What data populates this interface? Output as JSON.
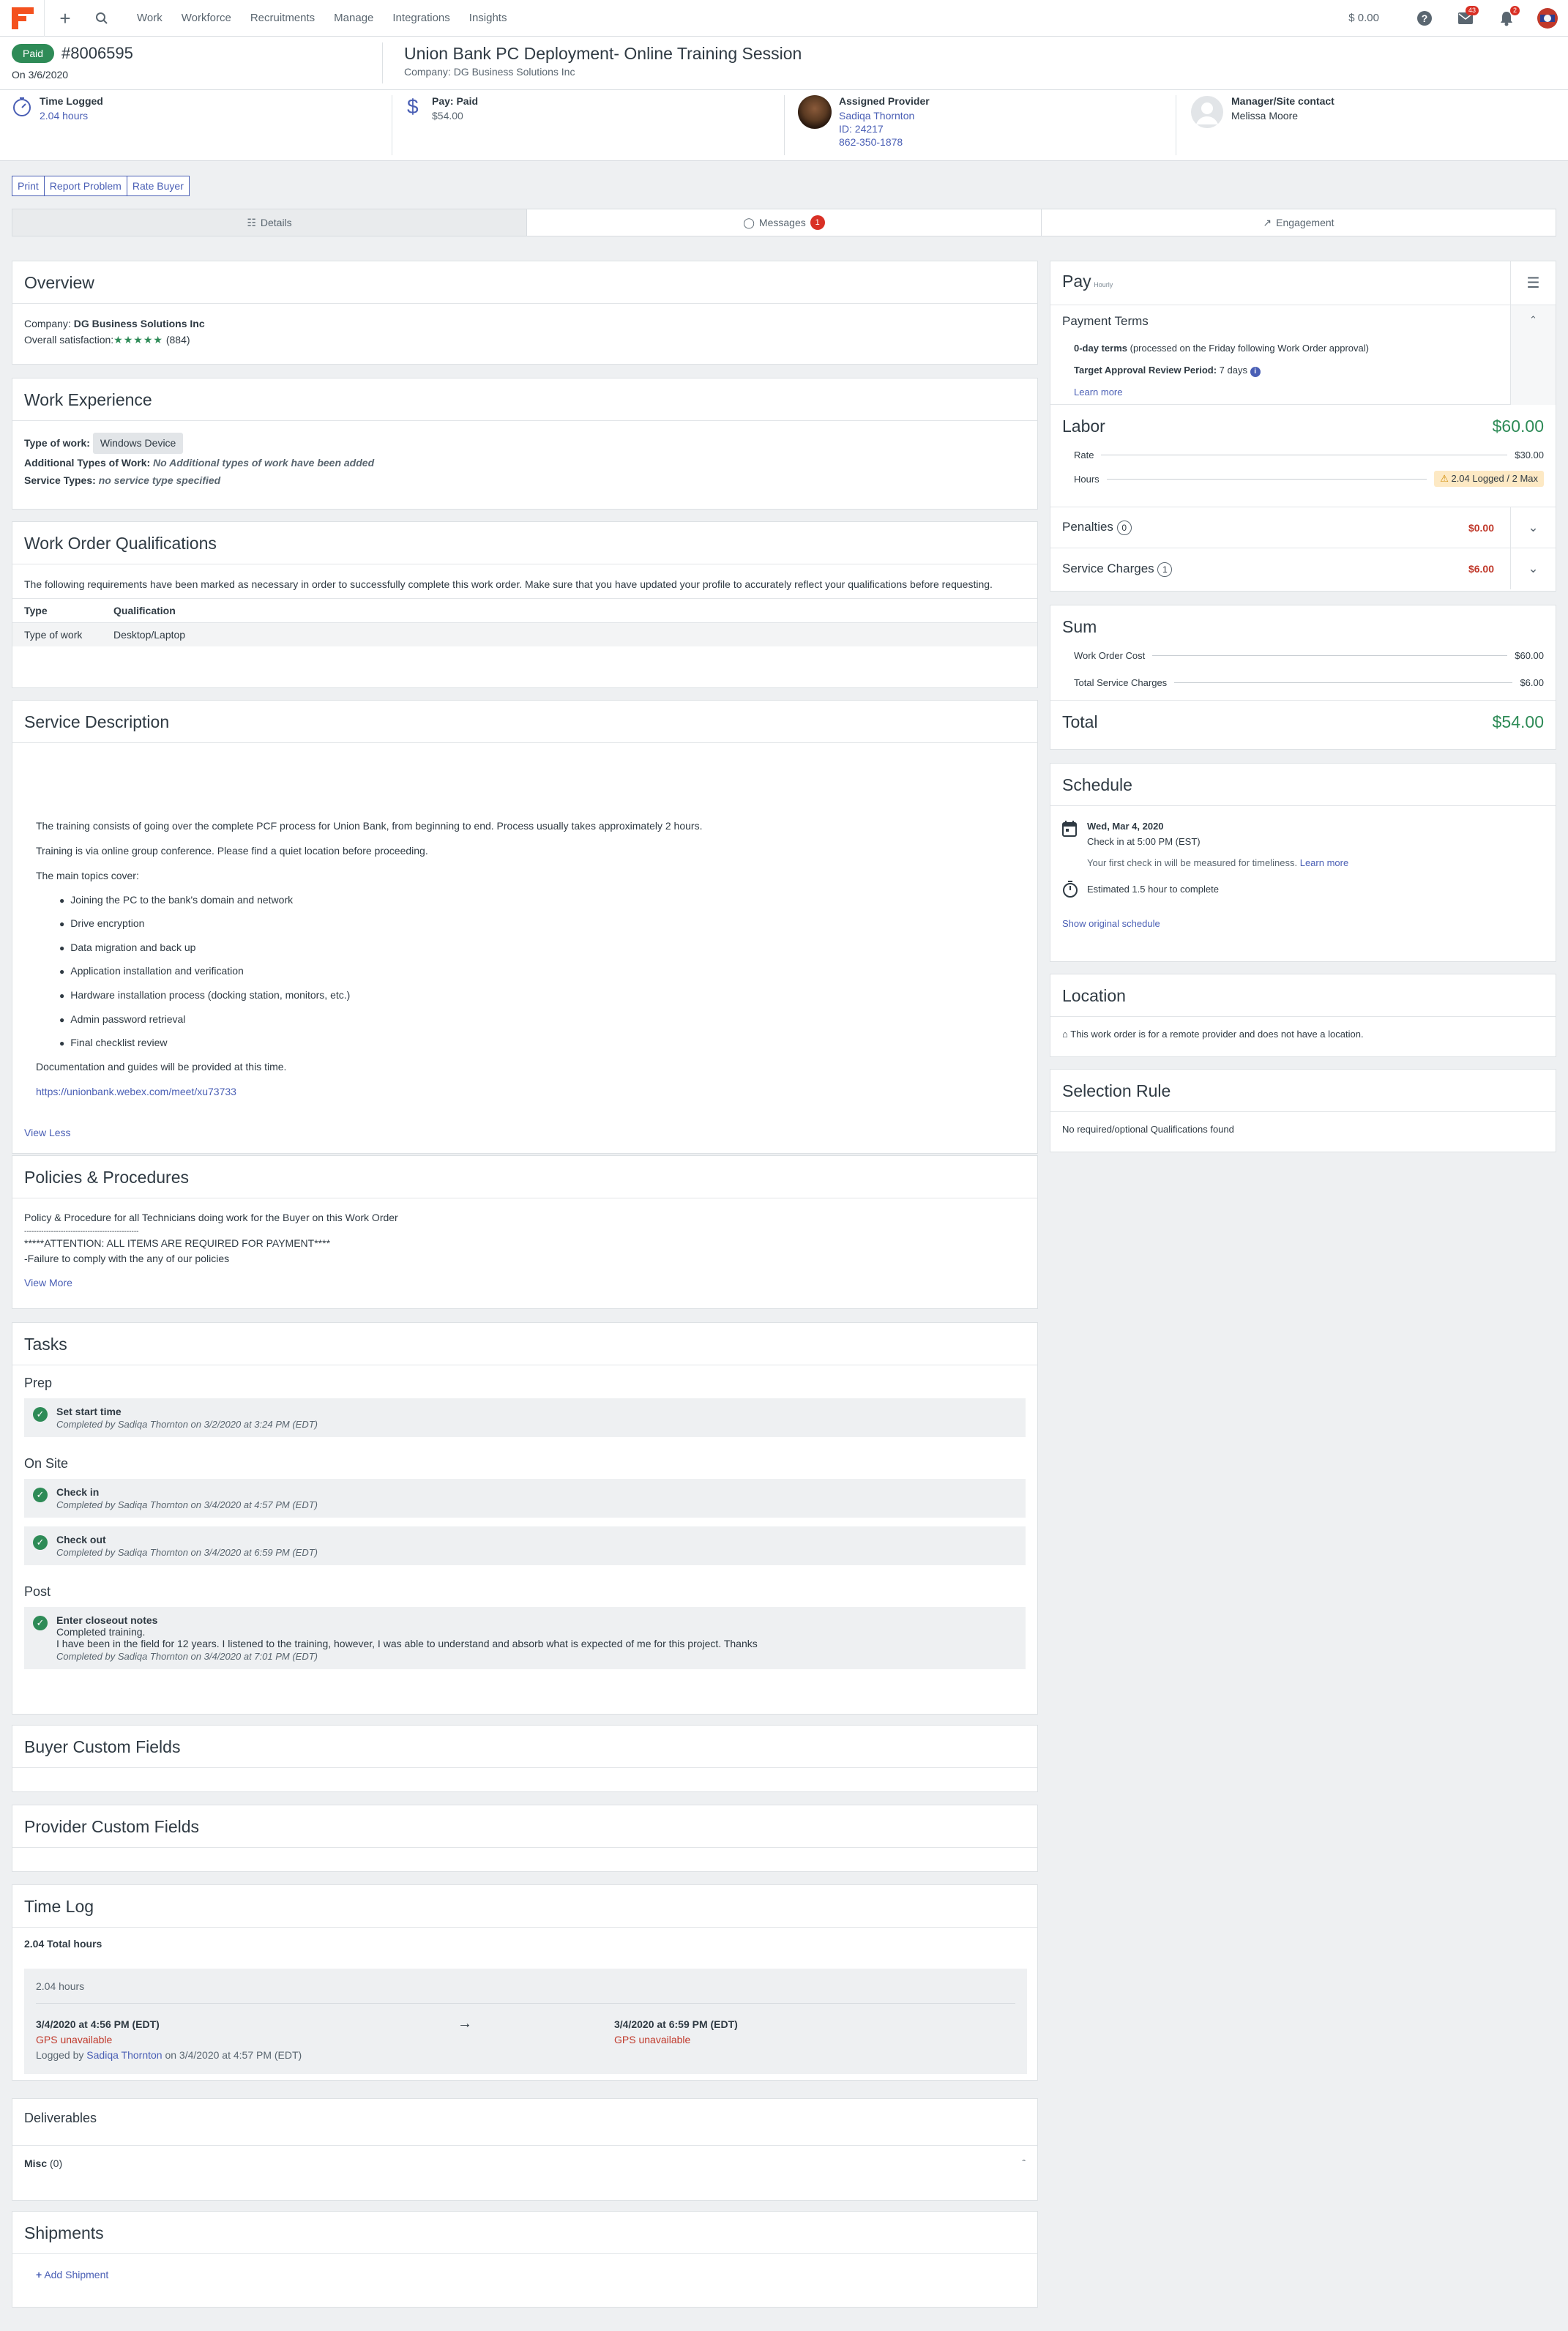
{
  "nav": {
    "items": [
      "Work",
      "Workforce",
      "Recruitments",
      "Manage",
      "Integrations",
      "Insights"
    ],
    "balance": "0.00",
    "messages_badge": "43",
    "notifications_badge": "2"
  },
  "header": {
    "status": "Paid",
    "work_order_number": "#8006595",
    "date": "On 3/6/2020",
    "title": "Union Bank PC Deployment- Online Training Session",
    "company": "Company: DG Business Solutions Inc",
    "time_logged_label": "Time Logged",
    "time_logged_value": "2.04 hours",
    "pay_label": "Pay: Paid",
    "pay_value": "$54.00",
    "provider_label": "Assigned Provider",
    "provider_name": "Sadiqa Thornton",
    "provider_id": "ID: 24217",
    "provider_phone": "862-350-1878",
    "manager_label": "Manager/Site contact",
    "manager_name": "Melissa Moore"
  },
  "actions": [
    "Print",
    "Report Problem",
    "Rate Buyer"
  ],
  "tabs": {
    "details": "Details",
    "messages": "Messages",
    "messages_count": "1",
    "engagement": "Engagement"
  },
  "overview": {
    "title": "Overview",
    "company_label": "Company:",
    "company_value": "DG Business Solutions Inc",
    "satisfaction_label": "Overall satisfaction:",
    "stars": "★★★★★",
    "rating_count": "(884)"
  },
  "work_experience": {
    "title": "Work Experience",
    "type_label": "Type of work:",
    "type_value": "Windows Device",
    "additional_label": "Additional Types of Work:",
    "additional_value": "No Additional types of work have been added",
    "service_label": "Service Types:",
    "service_value": "no service type specified"
  },
  "qualifications": {
    "title": "Work Order Qualifications",
    "intro": "The following requirements have been marked as necessary in order to successfully complete this work order. Make sure that you have updated your profile to accurately reflect your qualifications before requesting.",
    "headers": [
      "Type",
      "Qualification"
    ],
    "rows": [
      [
        "Type of work",
        "Desktop/Laptop"
      ]
    ]
  },
  "service_description": {
    "title": "Service Description",
    "p1": "The training consists of going over the complete PCF process for Union Bank, from beginning to end. Process usually takes approximately 2 hours.",
    "p2": "Training is via online group conference. Please find a quiet location before proceeding.",
    "p3": "The main topics cover:",
    "topics": [
      "Joining the PC to the bank's domain and network",
      "Drive encryption",
      "Data migration and back up",
      "Application installation and verification",
      "Hardware installation process (docking station, monitors, etc.)",
      "Admin password retrieval",
      "Final checklist review"
    ],
    "p4": "Documentation and guides will be provided at this time.",
    "url": "https://unionbank.webex.com/meet/xu73733",
    "view_less": "View Less"
  },
  "policies": {
    "title": "Policies & Procedures",
    "l1": "Policy & Procedure for all Technicians doing work for the Buyer on this Work Order",
    "l2": "-----------------------------------------------",
    "l3": "*****ATTENTION: ALL ITEMS ARE REQUIRED FOR PAYMENT****",
    "l4": "-Failure to comply with the any of our policies",
    "view_more": "View More"
  },
  "tasks": {
    "title": "Tasks",
    "prep": "Prep",
    "onsite": "On Site",
    "post": "Post",
    "t1": {
      "title": "Set start time",
      "meta": "Completed by Sadiqa Thornton on 3/2/2020 at 3:24 PM (EDT)"
    },
    "t2": {
      "title": "Check in",
      "meta": "Completed by Sadiqa Thornton on 3/4/2020 at 4:57 PM (EDT)"
    },
    "t3": {
      "title": "Check out",
      "meta": "Completed by Sadiqa Thornton on 3/4/2020 at 6:59 PM (EDT)"
    },
    "t4": {
      "title": "Enter closeout notes",
      "note1": "Completed training.",
      "note2": "I have been in the field for 12 years. I listened to the training, however, I was able to understand and absorb what is expected of me for this project. Thanks",
      "meta": "Completed by Sadiqa Thornton on 3/4/2020 at 7:01 PM (EDT)"
    }
  },
  "buyer_custom_fields": {
    "title": "Buyer Custom Fields"
  },
  "provider_custom_fields": {
    "title": "Provider Custom Fields"
  },
  "time_log": {
    "title": "Time Log",
    "total": "2.04 Total hours",
    "entry_hours": "2.04 hours",
    "start": "3/4/2020 at 4:56 PM (EDT)",
    "end": "3/4/2020 at 6:59 PM (EDT)",
    "gps": "GPS unavailable",
    "logged_by_prefix": "Logged by",
    "logged_by_name": "Sadiqa Thornton",
    "logged_by_suffix": "on 3/4/2020 at 4:57 PM (EDT)"
  },
  "deliverables": {
    "title": "Deliverables",
    "misc": "Misc",
    "misc_count": "(0)"
  },
  "shipments": {
    "title": "Shipments",
    "add": "Add Shipment"
  },
  "pay": {
    "title": "Pay",
    "subtitle": "Hourly",
    "payment_terms": "Payment Terms",
    "terms_bold": "0-day terms",
    "terms_rest": "(processed on the Friday following Work Order approval)",
    "review_label": "Target Approval Review Period:",
    "review_value": "7 days",
    "learn_more": "Learn more",
    "labor": "Labor",
    "labor_value": "$60.00",
    "rate_label": "Rate",
    "rate_value": "$30.00",
    "hours_label": "Hours",
    "hours_value": "2.04 Logged / 2 Max",
    "penalties": "Penalties",
    "penalties_count": "0",
    "penalties_value": "$0.00",
    "service_charges": "Service Charges",
    "service_charges_count": "1",
    "service_charges_value": "$6.00",
    "sum": "Sum",
    "wo_cost_label": "Work Order Cost",
    "wo_cost_value": "$60.00",
    "tsc_label": "Total Service Charges",
    "tsc_value": "$6.00",
    "total_label": "Total",
    "total_value": "$54.00"
  },
  "schedule": {
    "title": "Schedule",
    "date": "Wed, Mar 4, 2020",
    "checkin": "Check in at 5:00 PM (EST)",
    "note": "Your first check in will be measured for timeliness.",
    "learn_more": "Learn more",
    "estimate": "Estimated 1.5 hour to complete",
    "show_original": "Show original schedule"
  },
  "location": {
    "title": "Location",
    "text": "This work order is for a remote provider and does not have a location."
  },
  "selection_rule": {
    "title": "Selection Rule",
    "text": "No required/optional Qualifications found"
  },
  "colors": {
    "accent": "#4a5fb5",
    "success": "#2e8b57",
    "danger": "#c0392b",
    "brand": "#f4511e"
  }
}
